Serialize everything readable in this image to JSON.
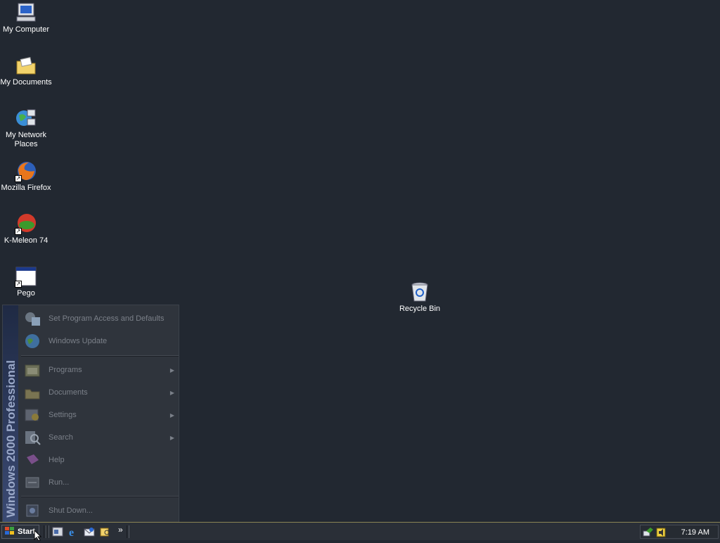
{
  "desktop": {
    "icons": [
      {
        "label": "My Computer"
      },
      {
        "label": "My Documents"
      },
      {
        "label": "My Network Places"
      },
      {
        "label": "Mozilla Firefox"
      },
      {
        "label": "K-Meleon 74"
      },
      {
        "label": "Pego"
      },
      {
        "label": "Recycle Bin"
      }
    ]
  },
  "start_menu": {
    "banner": "Windows 2000 Professional",
    "top_items": [
      {
        "label": "Set Program Access and Defaults"
      },
      {
        "label": "Windows Update"
      }
    ],
    "items": [
      {
        "label": "Programs"
      },
      {
        "label": "Documents"
      },
      {
        "label": "Settings"
      },
      {
        "label": "Search"
      },
      {
        "label": "Help"
      },
      {
        "label": "Run..."
      }
    ],
    "shutdown": "Shut Down..."
  },
  "taskbar": {
    "start_label": "Start",
    "chevron": "»",
    "clock": "7:19 AM"
  }
}
